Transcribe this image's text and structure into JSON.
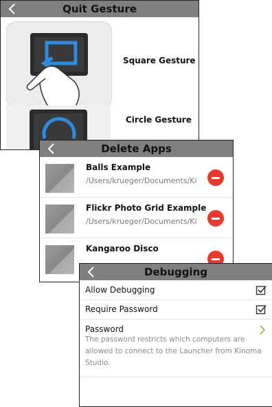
{
  "quit_gesture": {
    "title": "Quit Gesture",
    "options": [
      {
        "label": "Square Gesture",
        "icon": "square-gesture-icon"
      },
      {
        "label": "Circle Gesture",
        "icon": "circle-gesture-icon"
      }
    ]
  },
  "delete_apps": {
    "title": "Delete Apps",
    "apps": [
      {
        "name": "Balls Example",
        "path": "/Users/krueger/Documents/Ki"
      },
      {
        "name": "Flickr Photo Grid Example",
        "path": "/Users/krueger/Documents/Ki"
      },
      {
        "name": "Kangaroo Disco",
        "path": ""
      }
    ]
  },
  "debugging": {
    "title": "Debugging",
    "items": [
      {
        "label": "Allow Debugging",
        "control": "checkbox",
        "checked": true
      },
      {
        "label": "Require Password",
        "control": "checkbox",
        "checked": true
      },
      {
        "label": "Password",
        "control": "chevron",
        "description": "The password restricts which computers are allowed to connect to the Launcher from Kinoma Studio."
      }
    ]
  },
  "colors": {
    "titlebar": "#7f7f7f",
    "delete": "#e8392c",
    "chevron": "#7ac143",
    "gesture_accent": "#2f8be0"
  }
}
